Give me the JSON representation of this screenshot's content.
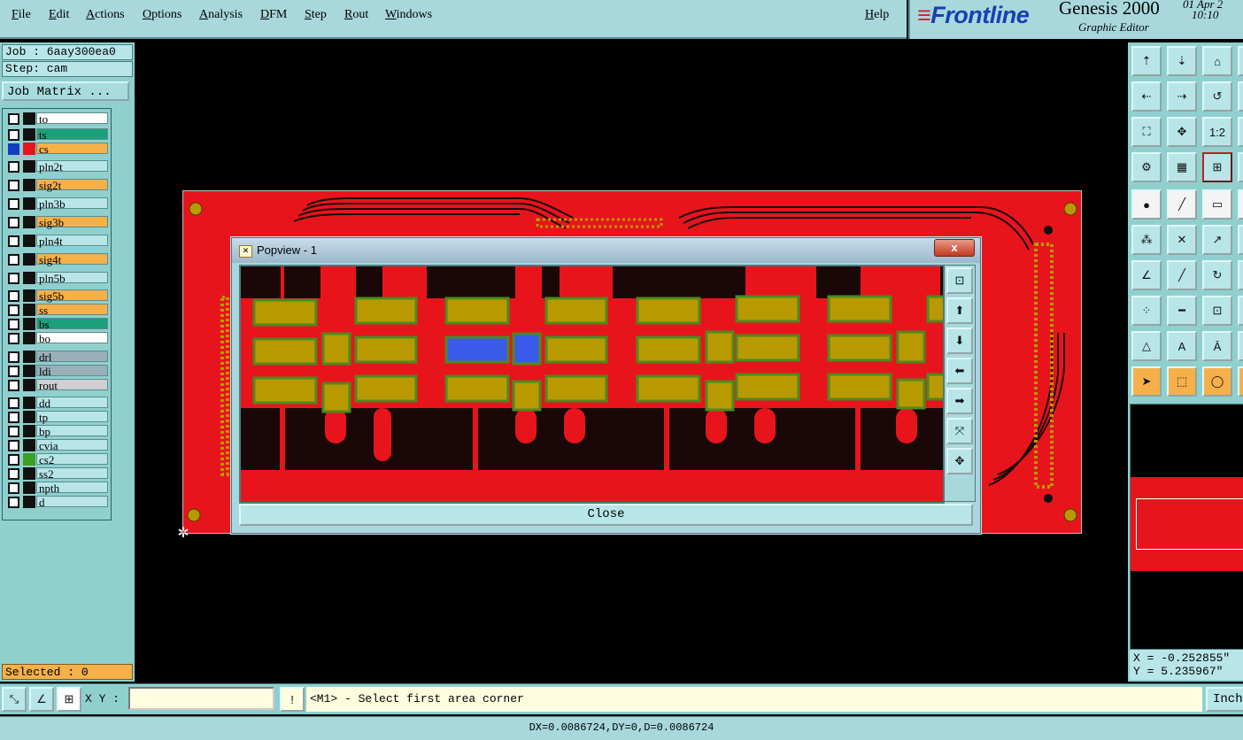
{
  "menu": {
    "items": [
      "File",
      "Edit",
      "Actions",
      "Options",
      "Analysis",
      "DFM",
      "Step",
      "Rout",
      "Windows"
    ],
    "help": "Help"
  },
  "brand": {
    "logo": "Frontline",
    "product": "Genesis 2000",
    "subtitle": "Graphic Editor",
    "date": "01 Apr 2",
    "time": "10:10"
  },
  "job": {
    "job_label": "Job : 6aay300ea0",
    "step_label": "Step: cam",
    "matrix_button": "Job Matrix ..."
  },
  "layers": [
    {
      "name": "to",
      "color": "#ffffff",
      "swatch": "#111111",
      "checked": false
    },
    {
      "name": "ts",
      "color": "#1aa07a",
      "swatch": "#111111",
      "checked": false
    },
    {
      "name": "cs",
      "color": "#f5b04a",
      "swatch": "#e8141c",
      "checked": true
    },
    {
      "name": "pln2t",
      "color": "#b8e6e8",
      "swatch": "#111111",
      "checked": false
    },
    {
      "name": "sig2t",
      "color": "#f5b04a",
      "swatch": "#111111",
      "checked": false
    },
    {
      "name": "pln3b",
      "color": "#b8e6e8",
      "swatch": "#111111",
      "checked": false
    },
    {
      "name": "sig3b",
      "color": "#f5b04a",
      "swatch": "#111111",
      "checked": false
    },
    {
      "name": "pln4t",
      "color": "#b8e6e8",
      "swatch": "#111111",
      "checked": false
    },
    {
      "name": "sig4t",
      "color": "#f5b04a",
      "swatch": "#111111",
      "checked": false
    },
    {
      "name": "pln5b",
      "color": "#b8e6e8",
      "swatch": "#111111",
      "checked": false
    },
    {
      "name": "sig5b",
      "color": "#f5b04a",
      "swatch": "#111111",
      "checked": false
    },
    {
      "name": "ss",
      "color": "#f5b04a",
      "swatch": "#111111",
      "checked": false
    },
    {
      "name": "bs",
      "color": "#1aa07a",
      "swatch": "#111111",
      "checked": false
    },
    {
      "name": "bo",
      "color": "#ffffff",
      "swatch": "#111111",
      "checked": false
    },
    {
      "name": "drl",
      "color": "#9ab0b8",
      "swatch": "#111111",
      "checked": false
    },
    {
      "name": "ldi",
      "color": "#9ab0b8",
      "swatch": "#111111",
      "checked": false
    },
    {
      "name": "rout",
      "color": "#d0d0d0",
      "swatch": "#111111",
      "checked": false
    },
    {
      "name": "dd",
      "color": "#b8e6e8",
      "swatch": "#111111",
      "checked": false
    },
    {
      "name": "tp",
      "color": "#b8e6e8",
      "swatch": "#111111",
      "checked": false
    },
    {
      "name": "bp",
      "color": "#b8e6e8",
      "swatch": "#111111",
      "checked": false
    },
    {
      "name": "cvia",
      "color": "#b8e6e8",
      "swatch": "#111111",
      "checked": false
    },
    {
      "name": "cs2",
      "color": "#b8e6e8",
      "swatch": "#3aa020",
      "checked": false
    },
    {
      "name": "ss2",
      "color": "#b8e6e8",
      "swatch": "#111111",
      "checked": false
    },
    {
      "name": "npth",
      "color": "#b8e6e8",
      "swatch": "#111111",
      "checked": false
    },
    {
      "name": "d",
      "color": "#b8e6e8",
      "swatch": "#111111",
      "checked": false
    }
  ],
  "selected_label": "Selected : 0",
  "popview": {
    "title": "Popview - 1",
    "close_x": "x",
    "close_button": "Close"
  },
  "toolbox": {
    "ratio_label": "1:2",
    "coord_x": "X = -0.252855\"",
    "coord_y": "Y = 5.235967\""
  },
  "command": {
    "xy_label": "X Y :",
    "xy_value": "",
    "warn": "!",
    "prompt": "<M1> - Select first area corner",
    "units_button": "Inch"
  },
  "status": "DX=0.0086724,DY=0,D=0.0086724",
  "colors": {
    "panel": "#8fd0cf",
    "copper": "#e8141c",
    "pad": "#b89a00",
    "pad_outline": "#4c8a20",
    "selected_pad": "#3a5ae8",
    "trace_dark": "#1a0808"
  }
}
